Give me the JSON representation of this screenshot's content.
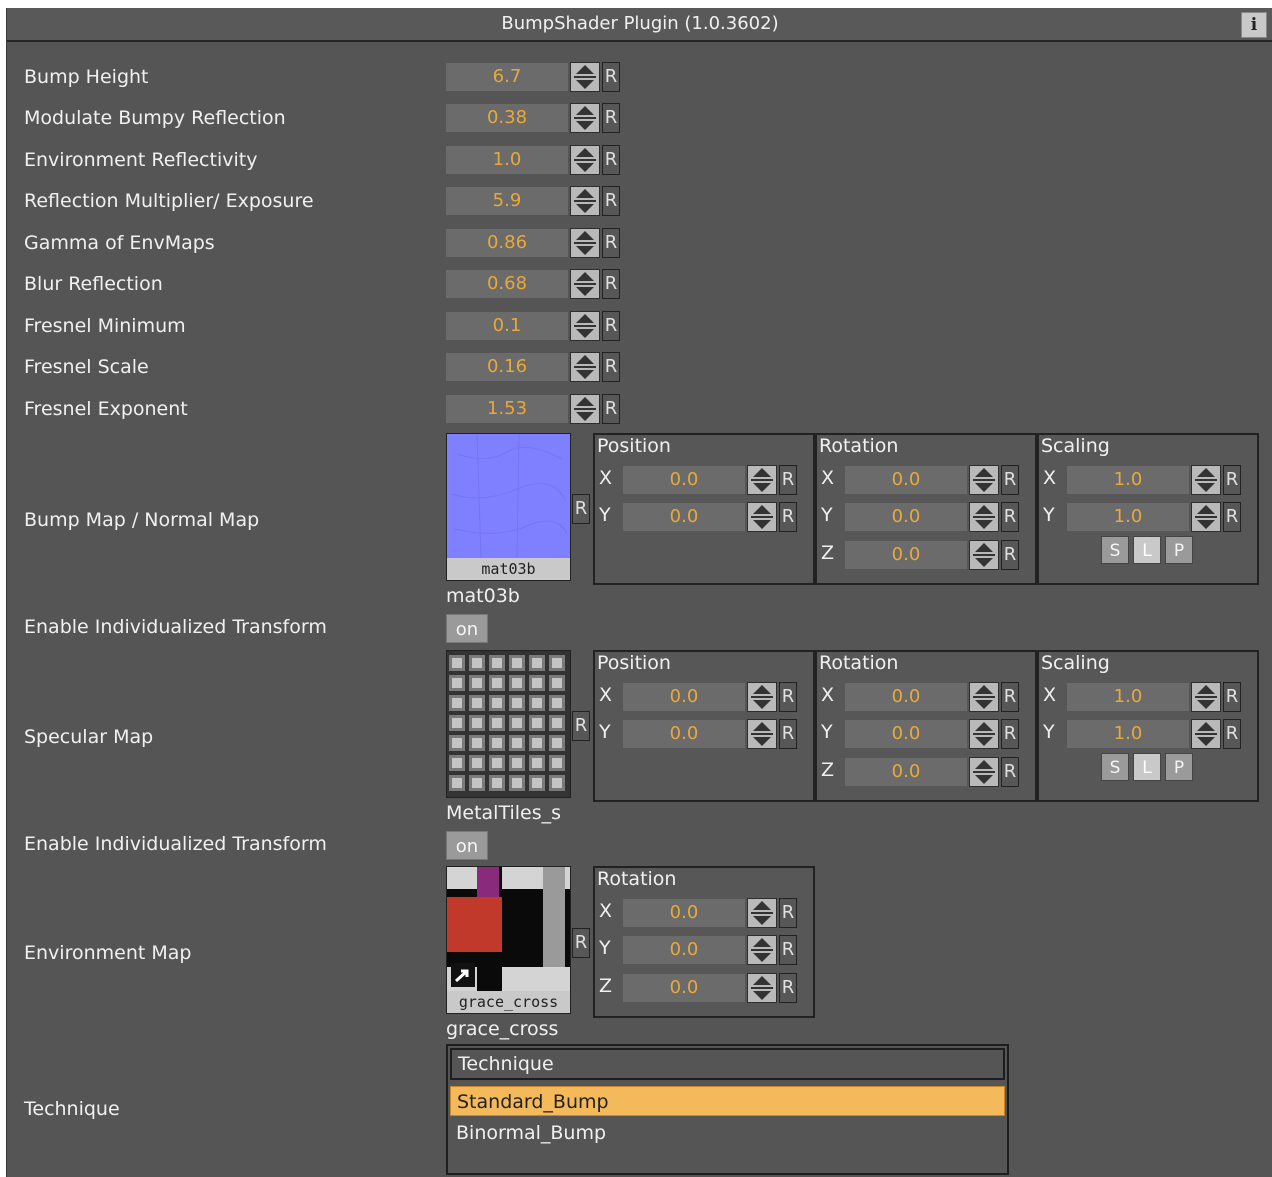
{
  "title": "BumpShader Plugin (1.0.3602)",
  "info_label": "i",
  "reset_label": "R",
  "params": [
    {
      "label": "Bump Height",
      "value": "6.7"
    },
    {
      "label": "Modulate Bumpy Reflection",
      "value": "0.38"
    },
    {
      "label": "Environment Reflectivity",
      "value": "1.0"
    },
    {
      "label": "Reflection Multiplier/ Exposure",
      "value": "5.9"
    },
    {
      "label": "Gamma of EnvMaps",
      "value": "0.86"
    },
    {
      "label": "Blur Reflection",
      "value": "0.68"
    },
    {
      "label": "Fresnel Minimum",
      "value": "0.1"
    },
    {
      "label": "Fresnel Scale",
      "value": "0.16"
    },
    {
      "label": "Fresnel Exponent",
      "value": "1.53"
    }
  ],
  "bump_map": {
    "label": "Bump Map / Normal Map",
    "thumb_caption": "mat03b",
    "name": "mat03b",
    "position_title": "Position",
    "rotation_title": "Rotation",
    "scaling_title": "Scaling",
    "pos_x": "0.0",
    "pos_y": "0.0",
    "rot_x": "0.0",
    "rot_y": "0.0",
    "rot_z": "0.0",
    "scale_x": "1.0",
    "scale_y": "1.0"
  },
  "enable_transform_1": {
    "label": "Enable Individualized Transform",
    "value": "on"
  },
  "specular_map": {
    "label": "Specular Map",
    "name": "MetalTiles_s",
    "position_title": "Position",
    "rotation_title": "Rotation",
    "scaling_title": "Scaling",
    "pos_x": "0.0",
    "pos_y": "0.0",
    "rot_x": "0.0",
    "rot_y": "0.0",
    "rot_z": "0.0",
    "scale_x": "1.0",
    "scale_y": "1.0"
  },
  "enable_transform_2": {
    "label": "Enable Individualized Transform",
    "value": "on"
  },
  "environment_map": {
    "label": "Environment Map",
    "thumb_caption": "grace_cross",
    "name": "grace_cross",
    "rotation_title": "Rotation",
    "rot_x": "0.0",
    "rot_y": "0.0",
    "rot_z": "0.0"
  },
  "axes": {
    "x": "X",
    "y": "Y",
    "z": "Z"
  },
  "scale_modes": {
    "s": "S",
    "l": "L",
    "p": "P"
  },
  "technique": {
    "label": "Technique",
    "header": "Technique",
    "options": [
      "Standard_Bump",
      "Binormal_Bump"
    ],
    "selected": "Standard_Bump"
  },
  "colors": {
    "panel": "#555555",
    "value_text": "#e8a93a",
    "selected": "#f4b95a"
  }
}
